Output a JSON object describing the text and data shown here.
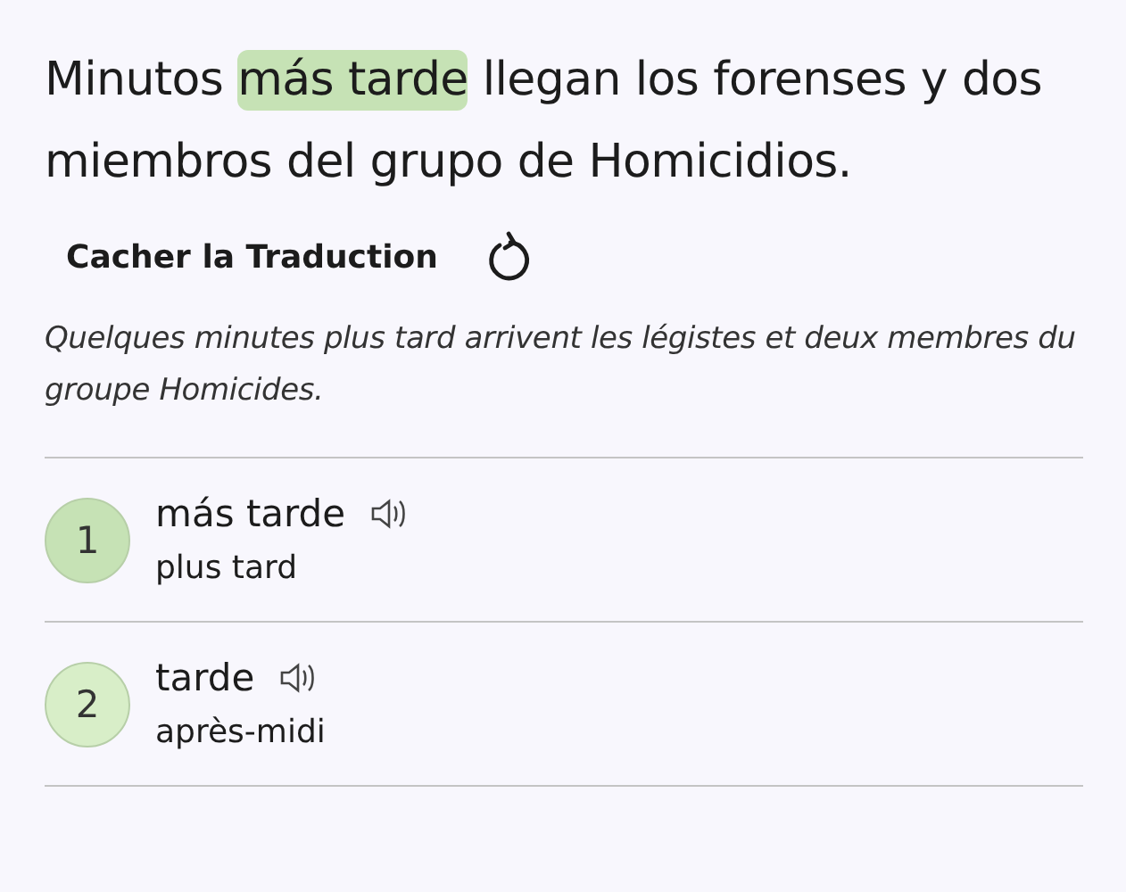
{
  "sentence": [
    {
      "text": "Minutos ",
      "highlighted": false
    },
    {
      "text": "más tarde",
      "highlighted": true
    },
    {
      "text": " llegan los forenses y dos miembros del grupo de Homicidios.",
      "highlighted": false
    }
  ],
  "translation_toggle": {
    "label": "Cacher la Traduction"
  },
  "translation": "Quelques minutes plus tard arrivent les légistes et deux membres du groupe Homicides.",
  "words": [
    {
      "number": "1",
      "term": "más tarde",
      "meaning": "plus tard",
      "color": "#c6e2b5"
    },
    {
      "number": "2",
      "term": "tarde",
      "meaning": "après-midi",
      "color": "#d8eec8"
    }
  ]
}
